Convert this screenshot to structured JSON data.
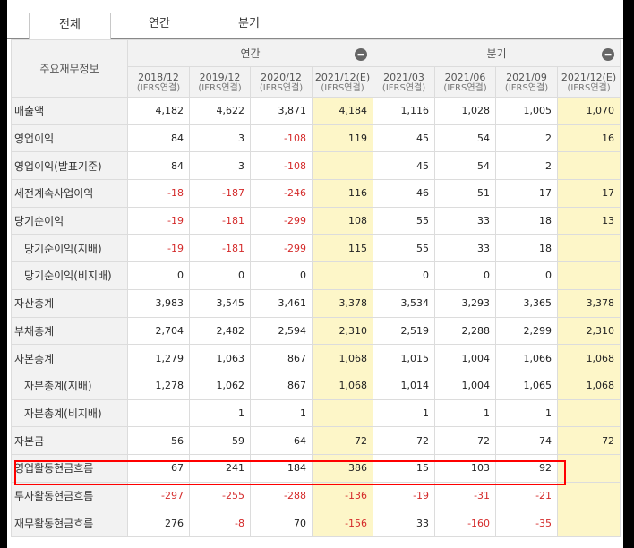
{
  "tabs": [
    {
      "label": "전체",
      "active": true
    },
    {
      "label": "연간",
      "active": false
    },
    {
      "label": "분기",
      "active": false
    }
  ],
  "table": {
    "corner_label": "주요재무정보",
    "groups": [
      {
        "label": "연간",
        "collapse_icon": "minus-circle-icon"
      },
      {
        "label": "분기",
        "collapse_icon": "minus-circle-icon"
      }
    ],
    "columns": [
      {
        "period": "2018/12",
        "basis": "(IFRS연결)",
        "estimate": false
      },
      {
        "period": "2019/12",
        "basis": "(IFRS연결)",
        "estimate": false
      },
      {
        "period": "2020/12",
        "basis": "(IFRS연결)",
        "estimate": false
      },
      {
        "period": "2021/12(E)",
        "basis": "(IFRS연결)",
        "estimate": true
      },
      {
        "period": "2021/03",
        "basis": "(IFRS연결)",
        "estimate": false
      },
      {
        "period": "2021/06",
        "basis": "(IFRS연결)",
        "estimate": false
      },
      {
        "period": "2021/09",
        "basis": "(IFRS연결)",
        "estimate": false
      },
      {
        "period": "2021/12(E)",
        "basis": "(IFRS연결)",
        "estimate": true
      }
    ],
    "rows": [
      {
        "label": "매출액",
        "indent": false,
        "values": [
          "4,182",
          "4,622",
          "3,871",
          "4,184",
          "1,116",
          "1,028",
          "1,005",
          "1,070"
        ]
      },
      {
        "label": "영업이익",
        "indent": false,
        "values": [
          "84",
          "3",
          "-108",
          "119",
          "45",
          "54",
          "2",
          "16"
        ]
      },
      {
        "label": "영업이익(발표기준)",
        "indent": false,
        "values": [
          "84",
          "3",
          "-108",
          "",
          "45",
          "54",
          "2",
          ""
        ]
      },
      {
        "label": "세전계속사업이익",
        "indent": false,
        "values": [
          "-18",
          "-187",
          "-246",
          "116",
          "46",
          "51",
          "17",
          "17"
        ]
      },
      {
        "label": "당기순이익",
        "indent": false,
        "values": [
          "-19",
          "-181",
          "-299",
          "108",
          "55",
          "33",
          "18",
          "13"
        ]
      },
      {
        "label": "당기순이익(지배)",
        "indent": true,
        "values": [
          "-19",
          "-181",
          "-299",
          "115",
          "55",
          "33",
          "18",
          ""
        ]
      },
      {
        "label": "당기순이익(비지배)",
        "indent": true,
        "values": [
          "0",
          "0",
          "0",
          "",
          "0",
          "0",
          "0",
          ""
        ]
      },
      {
        "label": "자산총계",
        "indent": false,
        "values": [
          "3,983",
          "3,545",
          "3,461",
          "3,378",
          "3,534",
          "3,293",
          "3,365",
          "3,378"
        ]
      },
      {
        "label": "부채총계",
        "indent": false,
        "values": [
          "2,704",
          "2,482",
          "2,594",
          "2,310",
          "2,519",
          "2,288",
          "2,299",
          "2,310"
        ]
      },
      {
        "label": "자본총계",
        "indent": false,
        "values": [
          "1,279",
          "1,063",
          "867",
          "1,068",
          "1,015",
          "1,004",
          "1,066",
          "1,068"
        ]
      },
      {
        "label": "자본총계(지배)",
        "indent": true,
        "values": [
          "1,278",
          "1,062",
          "867",
          "1,068",
          "1,014",
          "1,004",
          "1,065",
          "1,068"
        ]
      },
      {
        "label": "자본총계(비지배)",
        "indent": true,
        "values": [
          "",
          "1",
          "1",
          "",
          "1",
          "1",
          "1",
          ""
        ]
      },
      {
        "label": "자본금",
        "indent": false,
        "values": [
          "56",
          "59",
          "64",
          "72",
          "72",
          "72",
          "74",
          "72"
        ]
      },
      {
        "label": "영업활동현금흐름",
        "indent": false,
        "highlighted": true,
        "values": [
          "67",
          "241",
          "184",
          "386",
          "15",
          "103",
          "92",
          ""
        ]
      },
      {
        "label": "투자활동현금흐름",
        "indent": false,
        "values": [
          "-297",
          "-255",
          "-288",
          "-136",
          "-19",
          "-31",
          "-21",
          ""
        ]
      },
      {
        "label": "재무활동현금흐름",
        "indent": false,
        "values": [
          "276",
          "-8",
          "70",
          "-156",
          "33",
          "-160",
          "-35",
          ""
        ]
      }
    ]
  },
  "colors": {
    "negative": "#d42a2a",
    "estimate_bg": "#fdf6c8",
    "highlight_border": "#ff0000",
    "header_bg": "#f2f2f2"
  }
}
